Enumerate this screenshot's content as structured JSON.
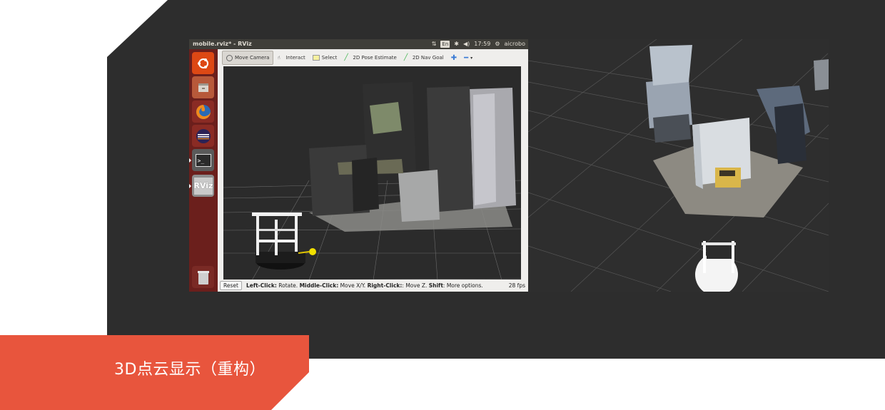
{
  "caption": "3D点云显示（重构）",
  "rviz": {
    "window_title": "mobile.rviz* - RViz",
    "topbar": {
      "keyboard": "En",
      "time": "17:59",
      "user": "aicrobo",
      "icons": [
        "network-icon",
        "bluetooth-icon",
        "volume-icon",
        "settings-gear-icon"
      ]
    },
    "launcher": [
      {
        "name": "ubuntu-dash-icon",
        "color": "#dd4814"
      },
      {
        "name": "file-manager-icon",
        "color": "#c46a3a"
      },
      {
        "name": "firefox-icon",
        "color": "#e66000"
      },
      {
        "name": "eclipse-icon",
        "color": "#2c2255"
      },
      {
        "name": "terminal-icon",
        "color": "#3a3a3a",
        "label": ">_"
      },
      {
        "name": "rviz-icon",
        "color": "#9a9a9a",
        "label": "RViz"
      },
      {
        "name": "trash-icon",
        "color": "#8a8a8a"
      }
    ],
    "toolbar": {
      "move_camera": "Move Camera",
      "interact": "Interact",
      "select": "Select",
      "pose_estimate": "2D Pose Estimate",
      "nav_goal": "2D Nav Goal"
    },
    "status": {
      "reset": "Reset",
      "left_click_key": "Left-Click:",
      "left_click_val": " Rotate. ",
      "middle_click_key": "Middle-Click:",
      "middle_click_val": " Move X/Y. ",
      "right_click_key": "Right-Click:",
      "right_click_val": ": Move Z. ",
      "shift_key": "Shift",
      "shift_val": ": More options.",
      "fps": "28 fps"
    }
  },
  "colors": {
    "caption_bg": "#e8553d",
    "panel_bg": "#2d2d2d",
    "launcher_bg": "#6b1f1c",
    "toolbar_bg": "#efeeec"
  }
}
